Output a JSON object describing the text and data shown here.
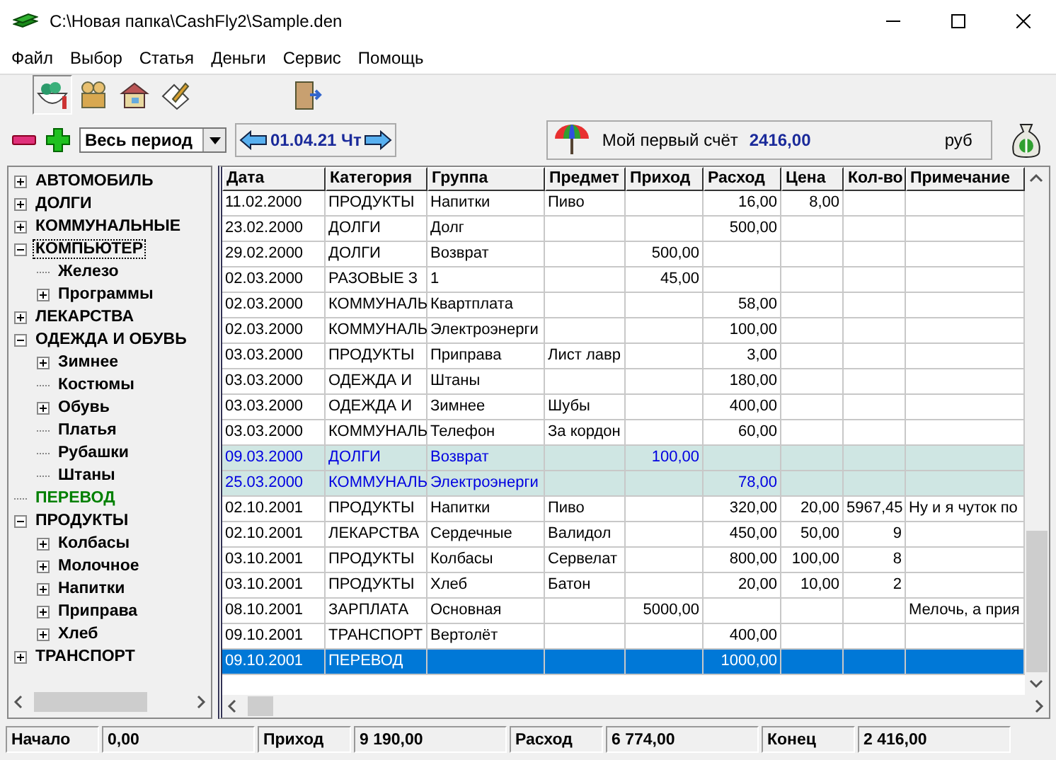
{
  "window": {
    "title": "C:\\Новая папка\\CashFly2\\Sample.den"
  },
  "menu": [
    "Файл",
    "Выбор",
    "Статья",
    "Деньги",
    "Сервис",
    "Помощь"
  ],
  "filter_bar": {
    "period": "Весь период",
    "date": "01.04.21 Чт",
    "account": "Мой первый счёт",
    "balance": "2416,00",
    "currency": "руб"
  },
  "tree": [
    {
      "label": "АВТОМОБИЛЬ",
      "kind": "category",
      "expanded": false,
      "focused": false
    },
    {
      "label": "ДОЛГИ",
      "kind": "category",
      "expanded": false,
      "focused": false
    },
    {
      "label": "КОММУНАЛЬНЫЕ",
      "kind": "category",
      "expanded": false,
      "focused": false
    },
    {
      "label": "КОМПЬЮТЕР",
      "kind": "category",
      "expanded": true,
      "focused": true,
      "children": [
        {
          "label": "Железо"
        },
        {
          "label": "Программы",
          "expanded": false
        }
      ]
    },
    {
      "label": "ЛЕКАРСТВА",
      "kind": "category",
      "expanded": false,
      "focused": false
    },
    {
      "label": "ОДЕЖДА И ОБУВЬ",
      "kind": "category",
      "expanded": true,
      "focused": false,
      "children": [
        {
          "label": "Зимнее",
          "expanded": false
        },
        {
          "label": "Костюмы"
        },
        {
          "label": "Обувь",
          "expanded": false
        },
        {
          "label": "Платья"
        },
        {
          "label": "Рубашки"
        },
        {
          "label": "Штаны"
        }
      ]
    },
    {
      "label": "ПЕРЕВОД",
      "kind": "transfer",
      "focused": false
    },
    {
      "label": "ПРОДУКТЫ",
      "kind": "category",
      "expanded": true,
      "focused": false,
      "children": [
        {
          "label": "Колбасы",
          "expanded": false
        },
        {
          "label": "Молочное",
          "expanded": false
        },
        {
          "label": "Напитки",
          "expanded": false
        },
        {
          "label": "Приправа",
          "expanded": false
        },
        {
          "label": "Хлеб",
          "expanded": false
        }
      ]
    },
    {
      "label": "ТРАНСПОРТ",
      "kind": "category",
      "expanded": false,
      "focused": false
    }
  ],
  "table": {
    "columns": [
      "Дата",
      "Категория",
      "Группа",
      "Предмет",
      "Приход",
      "Расход",
      "Цена",
      "Кол-во",
      "Примечание"
    ],
    "rows": [
      {
        "kind": "normal",
        "selected": false,
        "cells": [
          "11.02.2000",
          "ПРОДУКТЫ",
          "Напитки",
          "Пиво",
          "",
          "16,00",
          "8,00",
          "",
          ""
        ]
      },
      {
        "kind": "normal",
        "selected": false,
        "cells": [
          "23.02.2000",
          "ДОЛГИ",
          " Долг",
          "",
          "",
          "500,00",
          "",
          "",
          ""
        ]
      },
      {
        "kind": "normal",
        "selected": false,
        "cells": [
          "29.02.2000",
          "ДОЛГИ",
          "Возврат",
          "",
          "500,00",
          "",
          "",
          "",
          ""
        ]
      },
      {
        "kind": "normal",
        "selected": false,
        "cells": [
          "02.03.2000",
          "РАЗОВЫЕ З",
          "1",
          "",
          "45,00",
          "",
          "",
          "",
          ""
        ]
      },
      {
        "kind": "normal",
        "selected": false,
        "cells": [
          "02.03.2000",
          "КОММУНАЛЬ",
          "Квартплата",
          "",
          "",
          "58,00",
          "",
          "",
          ""
        ]
      },
      {
        "kind": "normal",
        "selected": false,
        "cells": [
          "02.03.2000",
          "КОММУНАЛЬ",
          "Электроэнерги",
          "",
          "",
          "100,00",
          "",
          "",
          ""
        ]
      },
      {
        "kind": "normal",
        "selected": false,
        "cells": [
          "03.03.2000",
          "ПРОДУКТЫ",
          "Приправа",
          "Лист лавр",
          "",
          "3,00",
          "",
          "",
          ""
        ]
      },
      {
        "kind": "normal",
        "selected": false,
        "cells": [
          "03.03.2000",
          "ОДЕЖДА И",
          "Штаны",
          "",
          "",
          "180,00",
          "",
          "",
          ""
        ]
      },
      {
        "kind": "normal",
        "selected": false,
        "cells": [
          "03.03.2000",
          "ОДЕЖДА И",
          "Зимнее",
          "Шубы",
          "",
          "400,00",
          "",
          "",
          ""
        ]
      },
      {
        "kind": "normal",
        "selected": false,
        "cells": [
          "03.03.2000",
          "КОММУНАЛЬ",
          "Телефон",
          "За кордон",
          "",
          "60,00",
          "",
          "",
          ""
        ]
      },
      {
        "kind": "planned",
        "selected": false,
        "cells": [
          "09.03.2000",
          "ДОЛГИ",
          "Возврат",
          "",
          "100,00",
          "",
          "",
          "",
          ""
        ]
      },
      {
        "kind": "planned",
        "selected": false,
        "cells": [
          "25.03.2000",
          "КОММУНАЛЬ",
          "Электроэнерги",
          "",
          "",
          "78,00",
          "",
          "",
          ""
        ]
      },
      {
        "kind": "normal",
        "selected": false,
        "cells": [
          "02.10.2001",
          "ПРОДУКТЫ",
          "Напитки",
          "Пиво",
          "",
          "320,00",
          "20,00",
          "5967,45",
          "Ну и я чуток по"
        ]
      },
      {
        "kind": "normal",
        "selected": false,
        "cells": [
          "02.10.2001",
          "ЛЕКАРСТВА",
          "Сердечные",
          "Валидол",
          "",
          "450,00",
          "50,00",
          "9",
          ""
        ]
      },
      {
        "kind": "normal",
        "selected": false,
        "cells": [
          "03.10.2001",
          "ПРОДУКТЫ",
          "Колбасы",
          "Сервелат",
          "",
          "800,00",
          "100,00",
          "8",
          ""
        ]
      },
      {
        "kind": "normal",
        "selected": false,
        "cells": [
          "03.10.2001",
          "ПРОДУКТЫ",
          "Хлеб",
          "Батон",
          "",
          "20,00",
          "10,00",
          "2",
          ""
        ]
      },
      {
        "kind": "normal",
        "selected": false,
        "cells": [
          "08.10.2001",
          "ЗАРПЛАТА",
          " Основная",
          "",
          "5000,00",
          "",
          "",
          "",
          "Мелочь, а прия"
        ]
      },
      {
        "kind": "normal",
        "selected": false,
        "cells": [
          "09.10.2001",
          "ТРАНСПОРТ",
          "Вертолёт",
          "",
          "",
          "400,00",
          "",
          "",
          ""
        ]
      },
      {
        "kind": "normal",
        "selected": true,
        "cells": [
          "09.10.2001",
          "ПЕРЕВОД",
          "",
          "",
          "",
          "1000,00",
          "",
          "",
          ""
        ]
      }
    ]
  },
  "status_bar": [
    {
      "label": "Начало",
      "value": "0,00"
    },
    {
      "label": "Приход",
      "value": "9 190,00"
    },
    {
      "label": "Расход",
      "value": "6 774,00"
    },
    {
      "label": "Конец",
      "value": "2 416,00"
    }
  ]
}
